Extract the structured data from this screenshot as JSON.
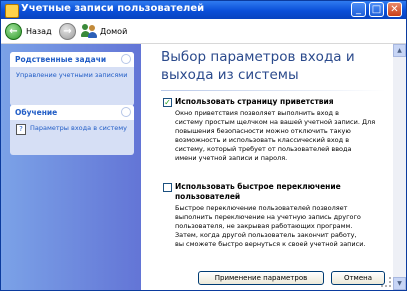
{
  "window": {
    "title": "Учетные записи пользователей",
    "minimize": "_",
    "maximize": "□",
    "close": "✕"
  },
  "toolbar": {
    "back_label": "Назад",
    "forward_arrow": "→",
    "back_arrow": "←",
    "home_label": "Домой"
  },
  "sidebar": {
    "tasks": {
      "title": "Родственные задачи",
      "items": [
        "Управление учетными записями"
      ]
    },
    "learn": {
      "title": "Обучение",
      "items": [
        "Параметры входа в систему"
      ]
    }
  },
  "main": {
    "heading": "Выбор параметров входа и выхода из системы",
    "option1": {
      "checked": true,
      "label": "Использовать страницу приветствия",
      "description": [
        "Окно приветствия позволяет выполнить вход в",
        "систему простым щелчком на вашей учетной записи. Для",
        "повышения безопасности можно отключить такую",
        "возможность и использовать классический вход в",
        "систему, который требует от пользователей ввода",
        "имени учетной записи и пароля."
      ]
    },
    "option2": {
      "checked": false,
      "label": "Использовать быстрое переключение пользователей",
      "label_lines": [
        "Использовать быстрое переключение",
        "пользователей"
      ],
      "description": [
        "Быстрое переключение пользователей позволяет",
        "выполнить переключение на учетную запись другого",
        "пользователя, не закрывая работающих программ.",
        "Затем, когда другой пользователь закончит работу,",
        "вы сможете быстро вернуться к своей учетной записи."
      ]
    },
    "apply_button": "Применение параметров",
    "cancel_button": "Отмена"
  },
  "colors": {
    "titlebar": "#0a4fd8",
    "sidebar": "#6e8de0",
    "heading": "#2b4a8c",
    "link": "#215dc6"
  }
}
